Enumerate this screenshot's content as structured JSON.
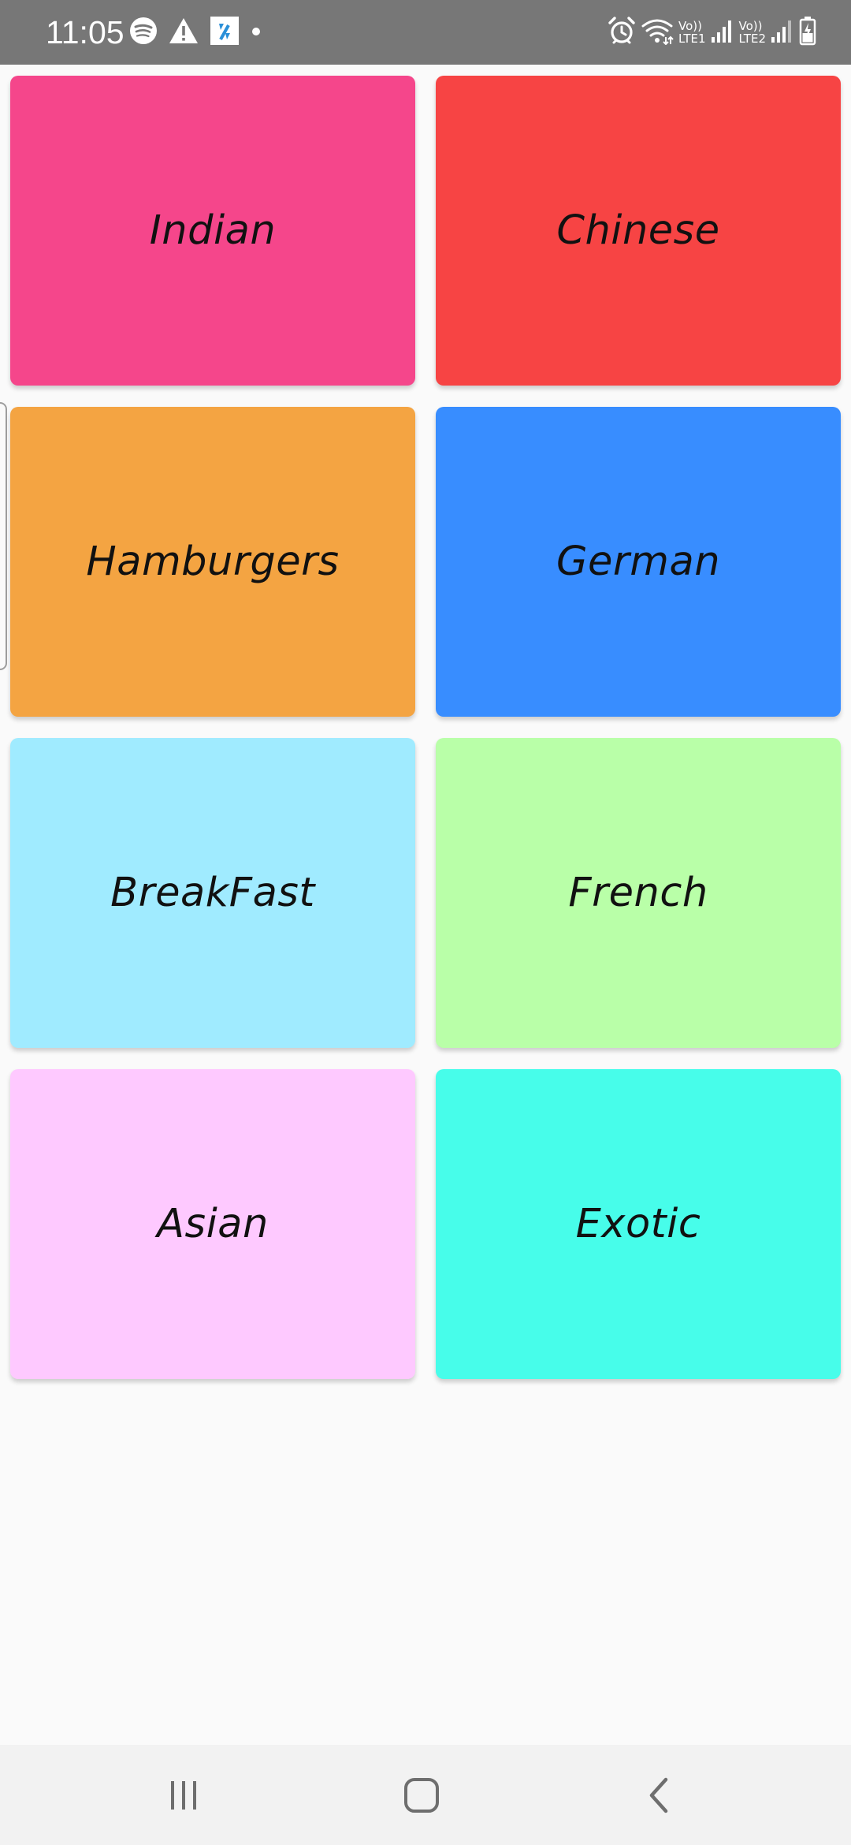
{
  "status_bar": {
    "time": "11:05",
    "left_icons": [
      "spotify-icon",
      "warning-icon",
      "app-notification-icon",
      "dot-icon"
    ],
    "right_icons": [
      "alarm-icon",
      "wifi-icon",
      "signal-sim1-icon",
      "signal-sim2-icon",
      "battery-charging-icon"
    ],
    "sim1_label_top": "Vo))",
    "sim1_label_bottom": "LTE1",
    "sim2_label_top": "Vo))",
    "sim2_label_bottom": "LTE2",
    "background_color": "#777777"
  },
  "categories": [
    {
      "label": "Indian",
      "color": "#f5468b"
    },
    {
      "label": "Chinese",
      "color": "#f74444"
    },
    {
      "label": "Hamburgers",
      "color": "#f4a442"
    },
    {
      "label": "German",
      "color": "#388dff"
    },
    {
      "label": "BreakFast",
      "color": "#a0ebff"
    },
    {
      "label": "French",
      "color": "#b9ffa8"
    },
    {
      "label": "Asian",
      "color": "#fec9ff"
    },
    {
      "label": "Exotic",
      "color": "#47fdea"
    }
  ],
  "nav_bar": {
    "buttons": [
      "recent-apps-icon",
      "home-icon",
      "back-icon"
    ]
  }
}
